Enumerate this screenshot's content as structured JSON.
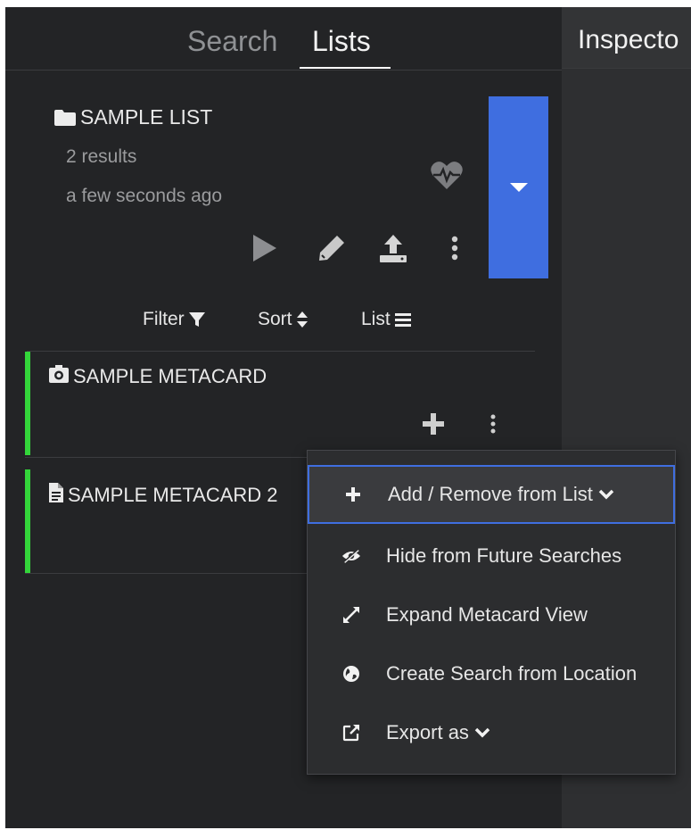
{
  "tabs": {
    "search_label": "Search",
    "lists_label": "Lists"
  },
  "inspector": {
    "title": "Inspecto"
  },
  "list": {
    "title": "SAMPLE LIST",
    "results": "2 results",
    "updated": "a few seconds ago"
  },
  "toolbar": {
    "filter_label": "Filter",
    "sort_label": "Sort",
    "list_label": "List"
  },
  "metacards": [
    {
      "title": "SAMPLE METACARD",
      "icon": "camera-icon"
    },
    {
      "title": "SAMPLE METACARD 2",
      "icon": "document-icon"
    }
  ],
  "menu": {
    "items": [
      {
        "label": "Add / Remove from List",
        "icon": "plus-icon"
      },
      {
        "label": "Hide from Future Searches",
        "icon": "eye-slash-icon"
      },
      {
        "label": "Expand Metacard View",
        "icon": "expand-icon"
      },
      {
        "label": "Create Search from Location",
        "icon": "globe-icon"
      },
      {
        "label": "Export as",
        "icon": "external-link-icon"
      }
    ]
  },
  "colors": {
    "accent": "#3f6ee0",
    "status_bar": "#33d63a",
    "panel_bg": "#232426"
  }
}
